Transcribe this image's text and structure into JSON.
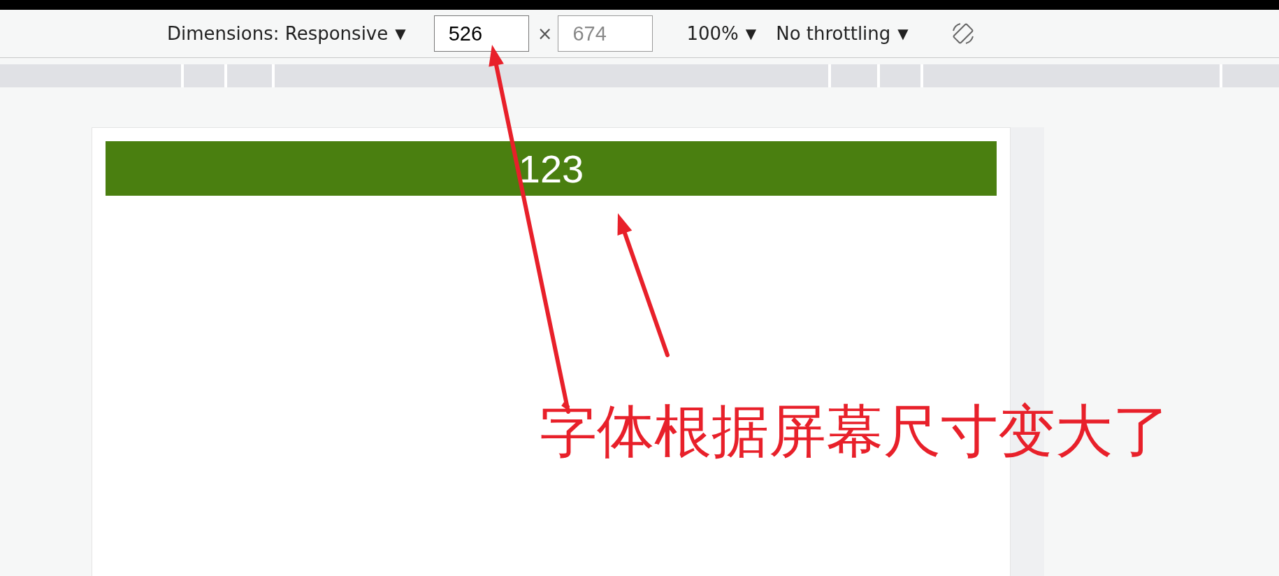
{
  "toolbar": {
    "dimensions": {
      "label": "Dimensions: Responsive",
      "caret": "▼"
    },
    "width_field": {
      "value": "526",
      "disabled": false
    },
    "times": "×",
    "height_field": {
      "value": "674",
      "disabled": true
    },
    "zoom": {
      "label": "100%",
      "caret": "▼"
    },
    "throttling": {
      "label": "No throttling",
      "caret": "▼"
    }
  },
  "page": {
    "banner": "123"
  },
  "annotation": {
    "text": "字体根据屏幕尺寸变大了"
  }
}
